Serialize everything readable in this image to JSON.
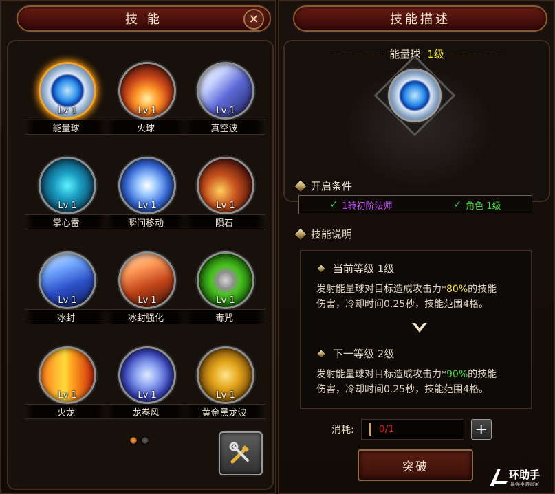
{
  "left_panel": {
    "title": "技 能",
    "close_icon": "close-x-icon"
  },
  "skills": [
    {
      "name": "能量球",
      "level": "Lv 1",
      "selected": true
    },
    {
      "name": "火球",
      "level": "Lv 1"
    },
    {
      "name": "真空波",
      "level": "Lv 1"
    },
    {
      "name": "掌心雷",
      "level": "Lv 1"
    },
    {
      "name": "瞬间移动",
      "level": "Lv 1"
    },
    {
      "name": "陨石",
      "level": "Lv 1"
    },
    {
      "name": "冰封",
      "level": "Lv 1"
    },
    {
      "name": "冰封强化",
      "level": "Lv 1"
    },
    {
      "name": "毒咒",
      "level": "Lv 1"
    },
    {
      "name": "火龙",
      "level": "Lv 1"
    },
    {
      "name": "龙卷风",
      "level": "Lv 1"
    },
    {
      "name": "黄金黑龙波",
      "level": "Lv 1"
    }
  ],
  "pager": {
    "current_page": 1,
    "total_pages": 2
  },
  "right_panel": {
    "title": "技能描述",
    "skill_name": "能量球",
    "skill_level": "1级",
    "conditions_header": "开启条件",
    "conditions": [
      {
        "text": "1转初阶法师",
        "color": "#c64dff"
      },
      {
        "text": "角色 1级",
        "color": "#43d83c"
      }
    ],
    "description_header": "技能说明",
    "current_level_label": "当前等级 1级",
    "current_desc_a": "发射能量球对目标造成攻击力*",
    "current_desc_pct": "80%",
    "current_desc_b": "的技能",
    "current_desc_line2": "伤害，冷却时间0.25秒，技能范围4格。",
    "next_level_label": "下一等级 2级",
    "next_desc_a": "发射能量球对目标造成攻击力*",
    "next_desc_pct": "90%",
    "next_desc_b": "的技能",
    "next_desc_line2": "伤害，冷却时间0.25秒，技能范围4格。",
    "cost_label": "消耗:",
    "cost_value": "0/1",
    "break_button": "突破"
  },
  "watermark": {
    "main": "环助手",
    "sub": "最强手游管家"
  },
  "colors": {
    "accent_gold": "#f2a526",
    "pct_yellow": "#f4e23a",
    "pct_green": "#43d83c",
    "cost_red": "#e8261e"
  }
}
